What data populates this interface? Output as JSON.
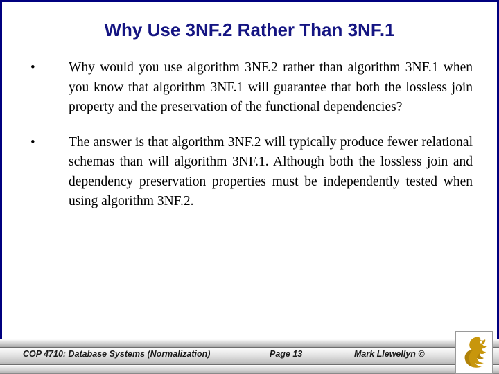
{
  "slide": {
    "title": "Why Use 3NF.2 Rather Than 3NF.1",
    "bullets": [
      {
        "marker": "•",
        "text": "Why would you use algorithm 3NF.2 rather than algorithm 3NF.1 when you know that algorithm 3NF.1 will guarantee that both the lossless join property and the preservation of the functional dependencies?"
      },
      {
        "marker": "•",
        "text": "The answer is that algorithm 3NF.2 will typically produce fewer relational schemas than will algorithm 3NF.1. Although both the lossless join and dependency preservation properties must be independently tested when using algorithm 3NF.2."
      }
    ]
  },
  "footer": {
    "course": "COP 4710: Database Systems  (Normalization)",
    "page": "Page 13",
    "author": "Mark Llewellyn ©",
    "logo_name": "ucf-pegasus-logo"
  },
  "colors": {
    "title_text": "#141482",
    "frame_border": "#00007f",
    "body_text": "#000000",
    "footer_text": "#1a1a1a",
    "logo_gold": "#c8960c",
    "logo_gold_dark": "#9c7208",
    "slide_background": "#ffffff"
  }
}
